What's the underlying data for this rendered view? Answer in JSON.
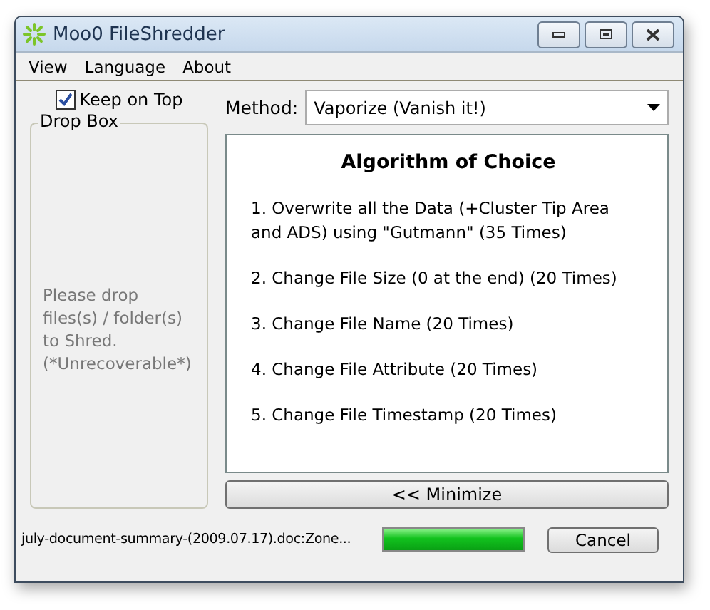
{
  "window": {
    "title": "Moo0 FileShredder"
  },
  "menu": [
    "View",
    "Language",
    "About"
  ],
  "keep_on_top": {
    "label": "Keep on Top",
    "checked": true
  },
  "drop_box": {
    "title": "Drop Box",
    "hint": "Please drop files(s) / folder(s) to Shred. (*Unrecoverable*)"
  },
  "method": {
    "label": "Method:",
    "value": "Vaporize (Vanish it!)"
  },
  "algorithm": {
    "title": "Algorithm of Choice",
    "steps": [
      "1. Overwrite all the Data (+Cluster Tip Area and ADS) using \"Gutmann\" (35 Times)",
      "2. Change File Size (0 at the end) (20 Times)",
      "3. Change File Name (20 Times)",
      "4. Change File Attribute (20 Times)",
      "5. Change File Timestamp (20 Times)"
    ]
  },
  "minimize_button": "<< Minimize",
  "status": {
    "file": "july-document-summary-(2009.07.17).doc:Zone...",
    "level": 1,
    "cancel": "Cancel"
  }
}
